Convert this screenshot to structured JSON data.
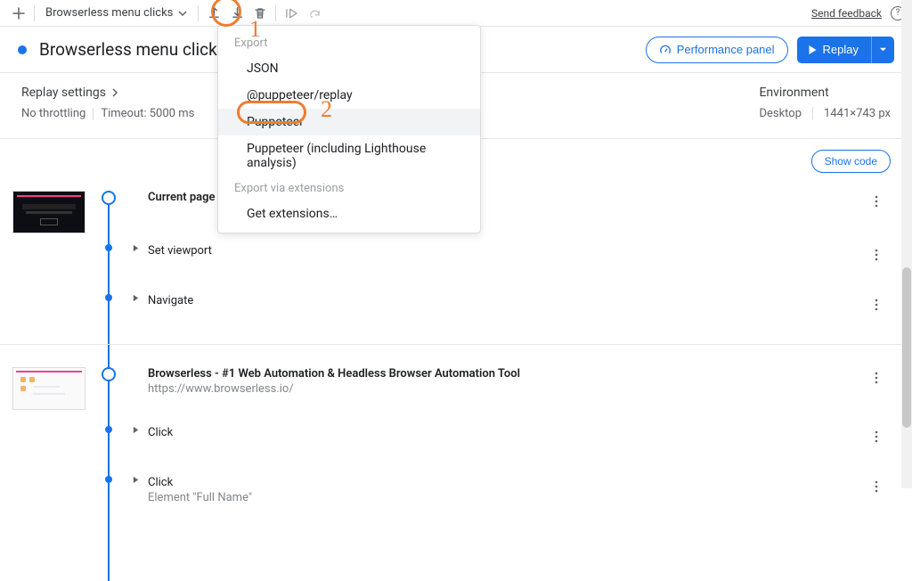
{
  "topbar": {
    "recording_name": "Browserless menu clicks",
    "feedback": "Send feedback"
  },
  "header": {
    "title": "Browserless menu clicks",
    "perf_panel": "Performance panel",
    "replay": "Replay"
  },
  "settings": {
    "label": "Replay settings",
    "throttling": "No throttling",
    "timeout": "Timeout: 5000 ms"
  },
  "env": {
    "label": "Environment",
    "device": "Desktop",
    "dims": "1441×743 px"
  },
  "tools": {
    "show_code": "Show code"
  },
  "menu": {
    "hdr_export": "Export",
    "json": "JSON",
    "puppeteer_replay": "@puppeteer/replay",
    "puppeteer": "Puppeteer",
    "puppeteer_lighthouse": "Puppeteer (including Lighthouse analysis)",
    "hdr_ext": "Export via extensions",
    "get_ext": "Get extensions…"
  },
  "sections": [
    {
      "title": "Current page",
      "url": "",
      "steps": [
        {
          "label": "Set viewport"
        },
        {
          "label": "Navigate"
        }
      ]
    },
    {
      "title": "Browserless - #1 Web Automation & Headless Browser Automation Tool",
      "url": "https://www.browserless.io/",
      "steps": [
        {
          "label": "Click",
          "sub": ""
        },
        {
          "label": "Click",
          "sub": "Element \"Full Name\""
        }
      ]
    }
  ],
  "anno": {
    "one": "1",
    "two": "2"
  }
}
